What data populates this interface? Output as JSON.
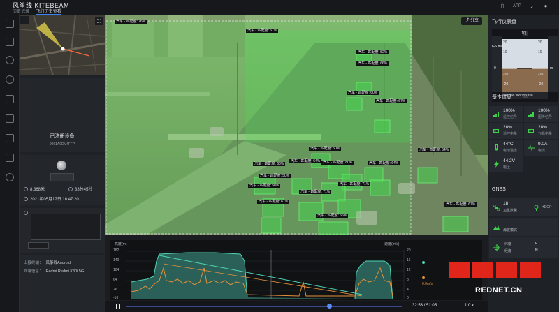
{
  "header": {
    "app_title": "风筝线 KITEBEAM",
    "crumbs": [
      "历史记录",
      "飞行历史查看"
    ],
    "app_label": "APP"
  },
  "device": {
    "name": "已注册设备",
    "id": "0061A0DV4FFP",
    "distance": "8,368米",
    "duration": "33分45秒",
    "datetime": "2021年05月17日 16:47:20"
  },
  "meta": {
    "uploader_label": "上报终端：",
    "uploader": "风筝线Android",
    "terminal_label": "终端信息：",
    "terminal": "Redmi Redmi K30i 5G..."
  },
  "video": {
    "share_label": "分享",
    "detections": [
      {
        "label": "汽车 - 匹配度: 76%"
      },
      {
        "label": "汽车 - 匹配度: 67%"
      },
      {
        "label": "汽车 - 匹配度: 52%"
      },
      {
        "label": "汽车 - 匹配度: 66%"
      },
      {
        "label": "汽车 - 匹配度: 60%"
      },
      {
        "label": "汽车 - 匹配度: 67%"
      },
      {
        "label": "汽车 - 匹配度: 50%"
      },
      {
        "label": "汽车 - 匹配度: 54%"
      },
      {
        "label": "汽车 - 匹配度: 60%"
      },
      {
        "label": "汽车 - 匹配度: 64%"
      },
      {
        "label": "汽车 - 匹配度: 80%"
      },
      {
        "label": "汽车 - 匹配度: 64%"
      },
      {
        "label": "汽车 - 匹配度: 50%"
      },
      {
        "label": "汽车 - 匹配度: 58%"
      },
      {
        "label": "汽车 - 匹配度: 71%"
      },
      {
        "label": "汽车 - 匹配度: 71%"
      },
      {
        "label": "汽车 - 匹配度: 67%"
      },
      {
        "label": "汽车 - 匹配度: 66%"
      },
      {
        "label": "汽车 - 匹配度: 67%"
      }
    ]
  },
  "chart": {
    "left_axis_label": "高度(m)",
    "right_axis_label": "速度(m/s)",
    "left_ticks": [
      "182",
      "140",
      "104",
      "64",
      "26",
      "-10"
    ],
    "right_ticks": [
      "20",
      "16",
      "12",
      "8",
      "4",
      "0"
    ],
    "legend_value": "0.0m/s"
  },
  "playback": {
    "time": "32:53 / 51:05",
    "speed": "1.0 x",
    "progress": 0.735
  },
  "instrument": {
    "title": "飞行仪表盘",
    "gs_label": "GS m/s",
    "heading": "|10|",
    "left_scale": [
      "20",
      "10",
      "0",
      "-10",
      "-20"
    ],
    "right_scale": [
      "20",
      "10",
      "0",
      "-10",
      "-20"
    ],
    "left_bottom": "0",
    "right_bottom": "m",
    "compass": "280 290 300 310 320",
    "compass_mark": "301"
  },
  "basic_info": {
    "title": "基本信息",
    "tiles": [
      {
        "value": "100%",
        "label": "遥控信号"
      },
      {
        "value": "100%",
        "label": "图传信号"
      },
      {
        "value": "28%",
        "label": "遥控电量"
      },
      {
        "value": "28%",
        "label": "飞机电量"
      },
      {
        "value": "44°C",
        "label": "电池温度"
      },
      {
        "value": "9.0A",
        "label": "电流"
      },
      {
        "value": "44.2V",
        "label": "电压"
      }
    ]
  },
  "gnss": {
    "title": "GNSS",
    "sat_value": "18",
    "sat_label": "卫星数量",
    "hdop_label": "HDOP",
    "mode_value": "-",
    "mode_label": "海拔模式",
    "lat_label": "纬度",
    "lat_dir": "E",
    "lon_label": "经度",
    "lon_dir": "N"
  },
  "watermark": {
    "text": "REDNET.CN"
  },
  "colors": {
    "accent": "#3b82f6",
    "detection_green": "#3fd04b",
    "chart_teal": "#4fd6b6",
    "chart_orange": "#e8913a"
  }
}
